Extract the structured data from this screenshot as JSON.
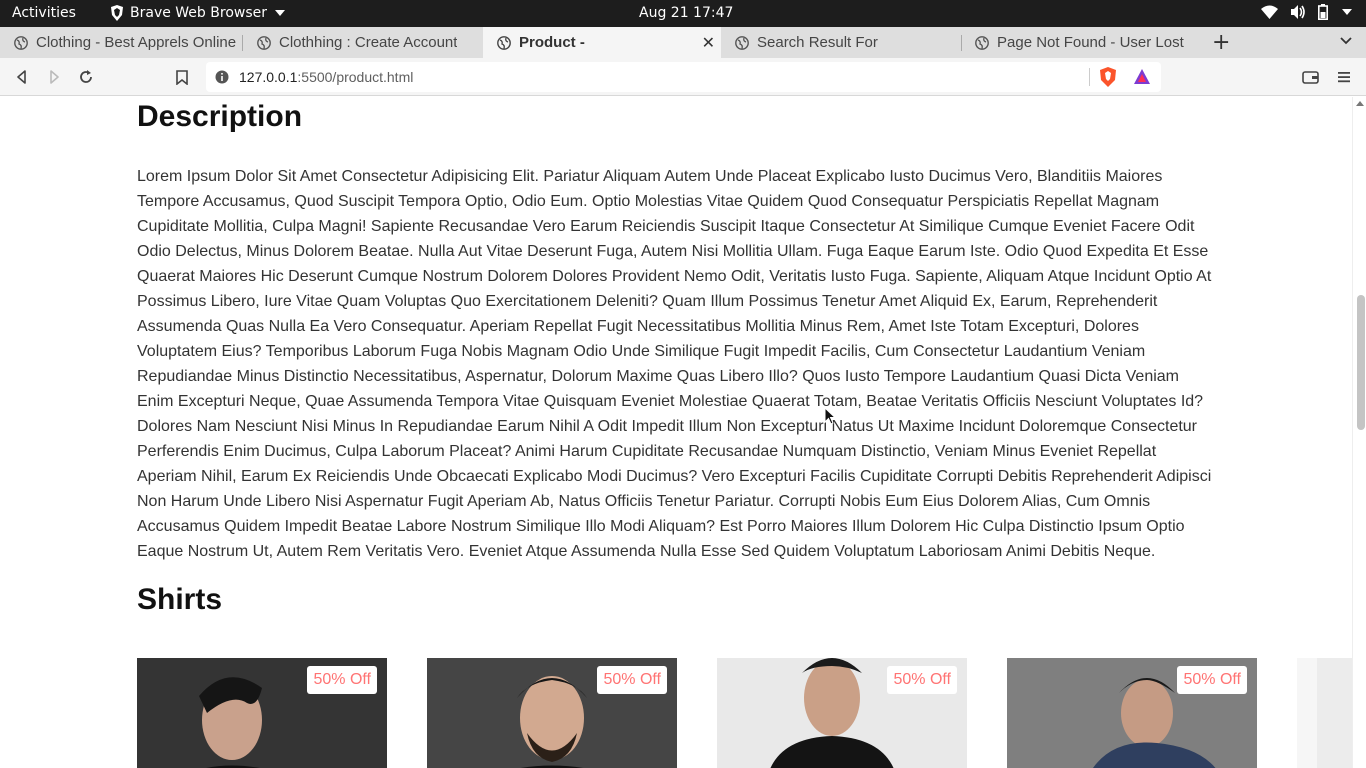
{
  "system": {
    "activities": "Activities",
    "app_name": "Brave Web Browser",
    "clock": "Aug 21  17:47"
  },
  "tabs": [
    {
      "title": "Clothing - Best Apprels Online",
      "active": false
    },
    {
      "title": "Clothhing : Create Account",
      "active": false
    },
    {
      "title": "Product -",
      "active": true
    },
    {
      "title": "Search Result For",
      "active": false
    },
    {
      "title": "Page Not Found - User Lost",
      "active": false
    }
  ],
  "toolbar": {
    "url_host": "127.0.0.1",
    "url_path": ":5500/product.html"
  },
  "page": {
    "description_heading": "Description",
    "description_text": "Lorem Ipsum Dolor Sit Amet Consectetur Adipisicing Elit. Pariatur Aliquam Autem Unde Placeat Explicabo Iusto Ducimus Vero, Blanditiis Maiores Tempore Accusamus, Quod Suscipit Tempora Optio, Odio Eum. Optio Molestias Vitae Quidem Quod Consequatur Perspiciatis Repellat Magnam Cupiditate Mollitia, Culpa Magni! Sapiente Recusandae Vero Earum Reiciendis Suscipit Itaque Consectetur At Similique Cumque Eveniet Facere Odit Odio Delectus, Minus Dolorem Beatae. Nulla Aut Vitae Deserunt Fuga, Autem Nisi Mollitia Ullam. Fuga Eaque Earum Iste. Odio Quod Expedita Et Esse Quaerat Maiores Hic Deserunt Cumque Nostrum Dolorem Dolores Provident Nemo Odit, Veritatis Iusto Fuga. Sapiente, Aliquam Atque Incidunt Optio At Possimus Libero, Iure Vitae Quam Voluptas Quo Exercitationem Deleniti? Quam Illum Possimus Tenetur Amet Aliquid Ex, Earum, Reprehenderit Assumenda Quas Nulla Ea Vero Consequatur. Aperiam Repellat Fugit Necessitatibus Mollitia Minus Rem, Amet Iste Totam Excepturi, Dolores Voluptatem Eius? Temporibus Laborum Fuga Nobis Magnam Odio Unde Similique Fugit Impedit Facilis, Cum Consectetur Laudantium Veniam Repudiandae Minus Distinctio Necessitatibus, Aspernatur, Dolorum Maxime Quas Libero Illo? Quos Iusto Tempore Laudantium Quasi Dicta Veniam Enim Excepturi Neque, Quae Assumenda Tempora Vitae Quisquam Eveniet Molestiae Quaerat Totam, Beatae Veritatis Officiis Nesciunt Voluptates Id? Dolores Nam Nesciunt Nisi Minus In Repudiandae Earum Nihil A Odit Impedit Illum Non Excepturi Natus Ut Maxime Incidunt Doloremque Consectetur Perferendis Enim Ducimus, Culpa Laborum Placeat? Animi Harum Cupiditate Recusandae Numquam Distinctio, Veniam Minus Eveniet Repellat Aperiam Nihil, Earum Ex Reiciendis Unde Obcaecati Explicabo Modi Ducimus? Vero Excepturi Facilis Cupiditate Corrupti Debitis Reprehenderit Adipisci Non Harum Unde Libero Nisi Aspernatur Fugit Aperiam Ab, Natus Officiis Tenetur Pariatur. Corrupti Nobis Eum Eius Dolorem Alias, Cum Omnis Accusamus Quidem Impedit Beatae Labore Nostrum Similique Illo Modi Aliquam? Est Porro Maiores Illum Dolorem Hic Culpa Distinctio Ipsum Optio Eaque Nostrum Ut, Autem Rem Veritatis Vero. Eveniet Atque Assumenda Nulla Esse Sed Quidem Voluptatum Laboriosam Animi Debitis Neque.",
    "section_title": "Shirts",
    "products": [
      {
        "badge": "50% Off"
      },
      {
        "badge": "50% Off"
      },
      {
        "badge": "50% Off"
      },
      {
        "badge": "50% Off"
      }
    ]
  },
  "colors": {
    "badge_text": "#ff7474",
    "top_bar": "#1d1d1d",
    "tab_strip": "#dedede",
    "brave_lion": "#fb542b"
  }
}
